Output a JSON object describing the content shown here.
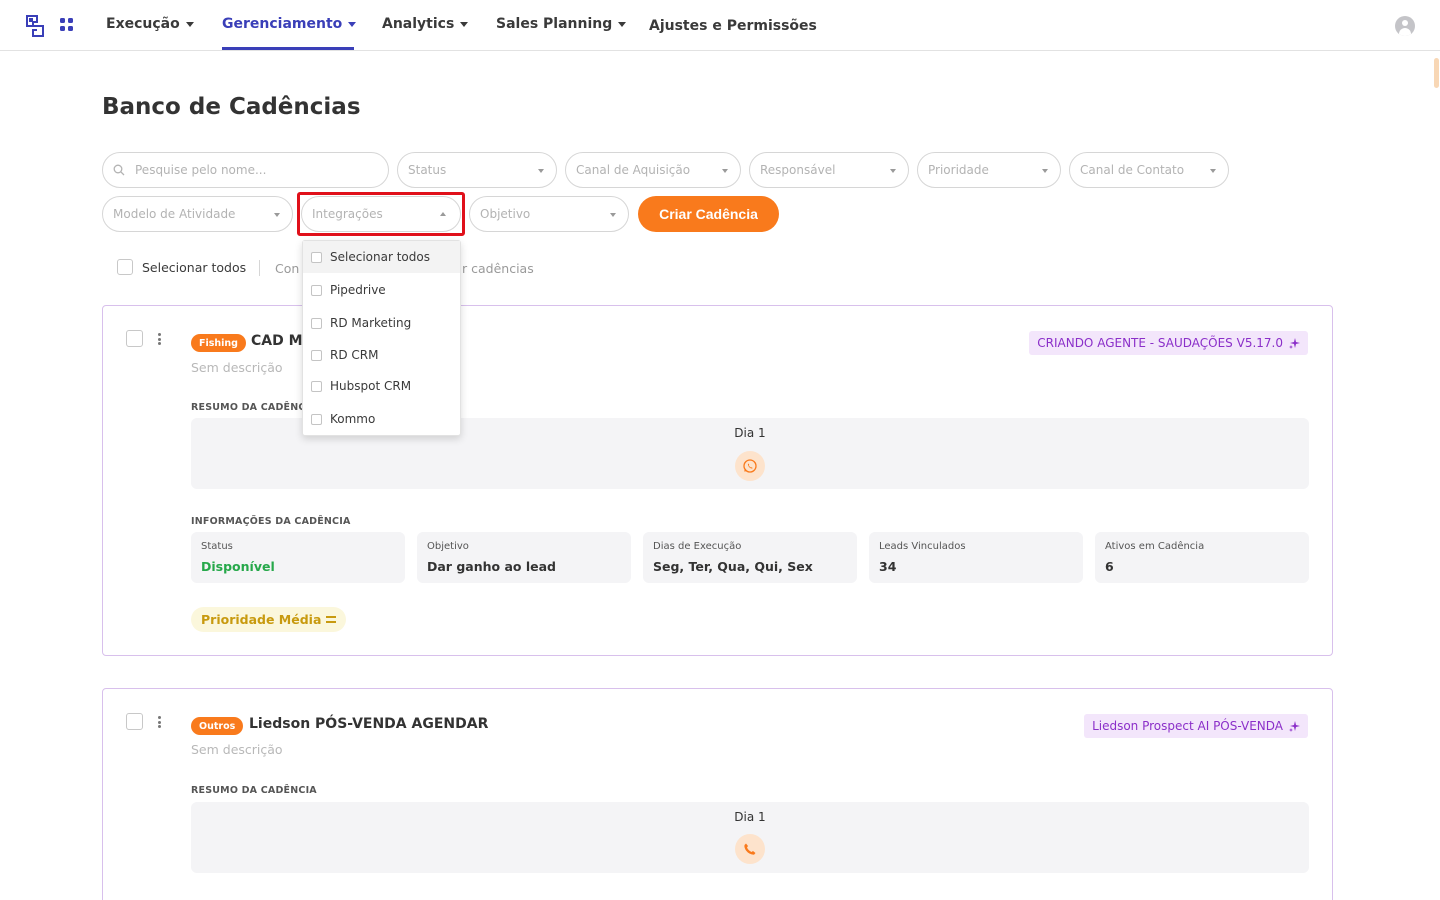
{
  "nav": {
    "items": [
      {
        "label": "Execução"
      },
      {
        "label": "Gerenciamento"
      },
      {
        "label": "Analytics"
      },
      {
        "label": "Sales Planning"
      },
      {
        "label": "Ajustes e Permissões"
      }
    ],
    "active": "Gerenciamento"
  },
  "page": {
    "title": "Banco de Cadências"
  },
  "filters": {
    "search_placeholder": "Pesquise pelo nome...",
    "status": "Status",
    "canal_aquisicao": "Canal de Aquisição",
    "responsavel": "Responsável",
    "prioridade": "Prioridade",
    "canal_contato": "Canal de Contato",
    "modelo_atividade": "Modelo de Atividade",
    "integracoes": "Integrações",
    "objetivo": "Objetivo",
    "create_button": "Criar Cadência"
  },
  "selection": {
    "select_all": "Selecionar todos",
    "action1": "Con",
    "action2": "r cadências"
  },
  "integrations_menu": {
    "items": [
      "Selecionar todos",
      "Pipedrive",
      "RD Marketing",
      "RD CRM",
      "Hubspot CRM",
      "Kommo"
    ]
  },
  "cards": [
    {
      "tag": "Fishing",
      "name": "CAD MA",
      "description": "Sem descrição",
      "agent": "CRIANDO AGENTE - SAUDAÇÕES V5.17.0",
      "summary_label": "RESUMO DA CADÊNCIA",
      "day": "Dia 1",
      "step_icon": "whatsapp-icon",
      "info_label": "INFORMAÇÕES DA CADÊNCIA",
      "info": [
        {
          "label": "Status",
          "value": "Disponível"
        },
        {
          "label": "Objetivo",
          "value": "Dar ganho ao lead"
        },
        {
          "label": "Dias de Execução",
          "value": "Seg, Ter, Qua, Qui, Sex"
        },
        {
          "label": "Leads Vinculados",
          "value": "34"
        },
        {
          "label": "Ativos em Cadência",
          "value": "6"
        }
      ],
      "priority": "Prioridade Média"
    },
    {
      "tag": "Outros",
      "name": "Liedson PÓS-VENDA AGENDAR",
      "description": "Sem descrição",
      "agent": "Liedson Prospect AI PÓS-VENDA",
      "summary_label": "RESUMO DA CADÊNCIA",
      "day": "Dia 1",
      "step_icon": "phone-icon"
    }
  ],
  "colors": {
    "accent": "#f97a1c",
    "nav_active": "#3a3fb8",
    "agent_text": "#8b2fc9",
    "status_available": "#26a84a",
    "priority_medium": "#c89a0f",
    "highlight": "#e0101a"
  }
}
